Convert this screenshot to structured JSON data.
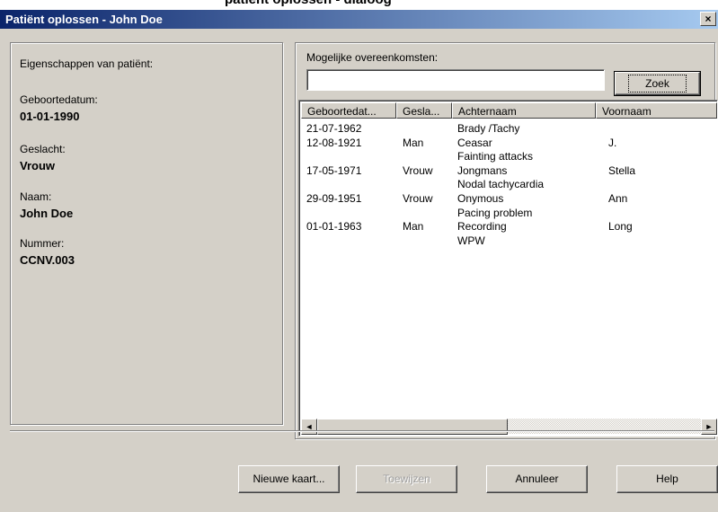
{
  "top_strip_text": "patiënt oplossen - dialoog",
  "window": {
    "title": "Patiënt oplossen - John Doe",
    "close_glyph": "×"
  },
  "patient_panel": {
    "heading": "Eigenschappen van patiënt:",
    "fields": [
      {
        "label": "Geboortedatum:",
        "value": "01-01-1990"
      },
      {
        "label": "Geslacht:",
        "value": "Vrouw"
      },
      {
        "label": "Naam:",
        "value": "John Doe"
      },
      {
        "label": "Nummer:",
        "value": "CCNV.003"
      }
    ]
  },
  "matches_panel": {
    "heading": "Mogelijke overeenkomsten:",
    "search_value": "",
    "search_button": "Zoek",
    "columns": [
      "Geboortedat...",
      "Gesla...",
      "Achternaam",
      "Voornaam"
    ],
    "rows": [
      [
        "21-07-1962",
        "",
        "Brady /Tachy",
        ""
      ],
      [
        "12-08-1921",
        "Man",
        "Ceasar",
        "J."
      ],
      [
        "",
        "",
        "Fainting attacks",
        ""
      ],
      [
        "17-05-1971",
        "Vrouw",
        "Jongmans",
        "Stella"
      ],
      [
        "",
        "",
        "Nodal tachycardia",
        ""
      ],
      [
        "29-09-1951",
        "Vrouw",
        "Onymous",
        "Ann"
      ],
      [
        "",
        "",
        "Pacing problem",
        ""
      ],
      [
        "01-01-1963",
        "Man",
        "Recording",
        "Long"
      ],
      [
        "",
        "",
        "WPW",
        ""
      ]
    ],
    "scroll_left_glyph": "◄",
    "scroll_right_glyph": "►"
  },
  "buttons": {
    "new_card": "Nieuwe kaart...",
    "assign": "Toewijzen",
    "cancel": "Annuleer",
    "help": "Help"
  },
  "colors": {
    "face": "#d4d0c8",
    "title_start": "#0a246a",
    "title_end": "#a6caf0"
  }
}
